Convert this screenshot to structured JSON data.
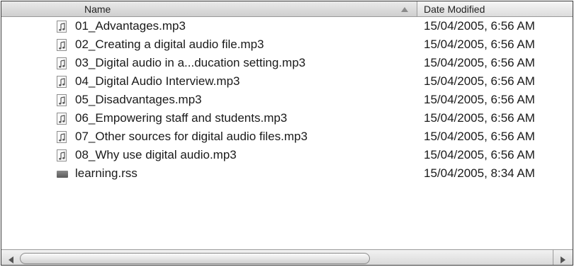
{
  "columns": {
    "name_label": "Name",
    "date_label": "Date Modified",
    "sort_direction": "ascending"
  },
  "files": [
    {
      "name": "01_Advantages.mp3",
      "date": "15/04/2005, 6:56 AM",
      "icon": "music-file-icon"
    },
    {
      "name": "02_Creating a digital audio file.mp3",
      "date": "15/04/2005, 6:56 AM",
      "icon": "music-file-icon"
    },
    {
      "name": "03_Digital audio in a...ducation setting.mp3",
      "date": "15/04/2005, 6:56 AM",
      "icon": "music-file-icon"
    },
    {
      "name": "04_Digital Audio Interview.mp3",
      "date": "15/04/2005, 6:56 AM",
      "icon": "music-file-icon"
    },
    {
      "name": "05_Disadvantages.mp3",
      "date": "15/04/2005, 6:56 AM",
      "icon": "music-file-icon"
    },
    {
      "name": "06_Empowering staff and students.mp3",
      "date": "15/04/2005, 6:56 AM",
      "icon": "music-file-icon"
    },
    {
      "name": "07_Other sources for digital audio files.mp3",
      "date": "15/04/2005, 6:56 AM",
      "icon": "music-file-icon"
    },
    {
      "name": "08_Why use digital audio.mp3",
      "date": "15/04/2005, 6:56 AM",
      "icon": "music-file-icon"
    },
    {
      "name": "learning.rss",
      "date": "15/04/2005, 8:34 AM",
      "icon": "rss-file-icon"
    }
  ]
}
